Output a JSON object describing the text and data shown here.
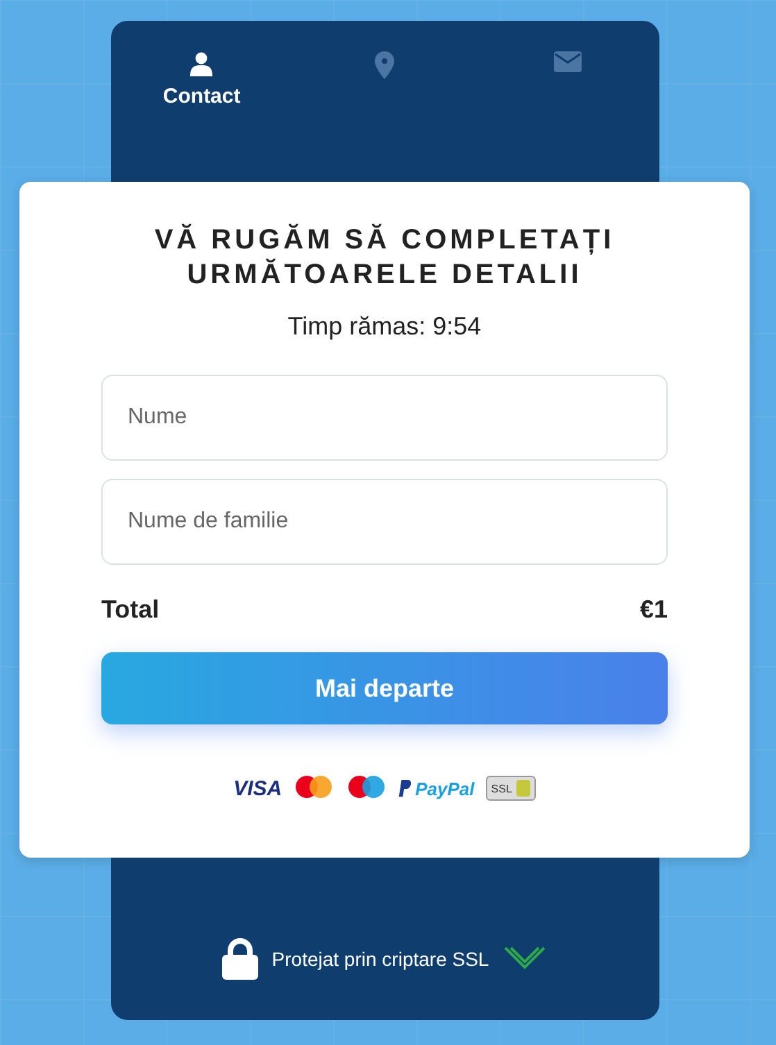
{
  "tabs": [
    {
      "kind": "person",
      "label": "Contact",
      "selected": true
    },
    {
      "kind": "pin",
      "selected": false
    },
    {
      "kind": "mail",
      "selected": false
    }
  ],
  "form": {
    "title": "VĂ RUGĂM SĂ COMPLETAȚI URMĂTOARELE DETALII",
    "timer": "Timp rămas: 9:54",
    "fields": [
      {
        "placeholder": "Nume"
      },
      {
        "placeholder": "Nume de familie"
      }
    ],
    "total": {
      "label": "Total",
      "value": "€1"
    },
    "button": "Mai departe",
    "payment_logos": [
      {
        "kind": "visa",
        "label": "VISA"
      },
      {
        "kind": "mastercard"
      },
      {
        "kind": "maestro"
      },
      {
        "kind": "paypal",
        "label": "PayPal"
      },
      {
        "kind": "ssl",
        "label": "SSL"
      }
    ]
  },
  "footer": {
    "text": "Protejat prin criptare SSL"
  }
}
